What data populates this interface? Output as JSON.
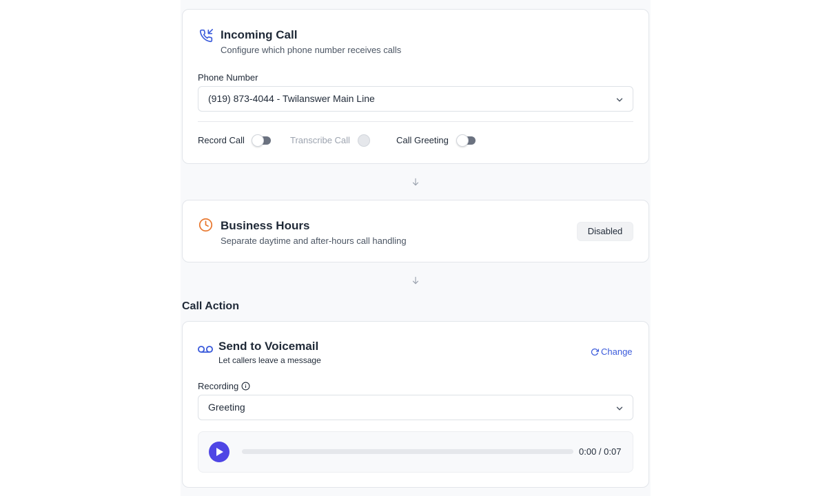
{
  "incoming": {
    "title": "Incoming Call",
    "subtitle": "Configure which phone number receives calls",
    "phone_label": "Phone Number",
    "phone_value": "(919) 873-4044 - Twilanswer Main Line",
    "toggles": [
      {
        "label": "Record Call",
        "enabled": true,
        "on": false
      },
      {
        "label": "Transcribe Call",
        "enabled": false,
        "on": false
      },
      {
        "label": "Call Greeting",
        "enabled": true,
        "on": false
      }
    ]
  },
  "business_hours": {
    "title": "Business Hours",
    "subtitle": "Separate daytime and after-hours call handling",
    "status": "Disabled"
  },
  "call_action": {
    "section_title": "Call Action",
    "title": "Send to Voicemail",
    "subtitle": "Let callers leave a message",
    "change_label": "Change",
    "recording_label": "Recording",
    "recording_value": "Greeting",
    "player": {
      "time": "0:00 / 0:07",
      "progress": 0
    }
  },
  "colors": {
    "accent_blue": "#3b5bdb",
    "clock_orange": "#e8772e",
    "play_purple": "#4f46e5"
  }
}
